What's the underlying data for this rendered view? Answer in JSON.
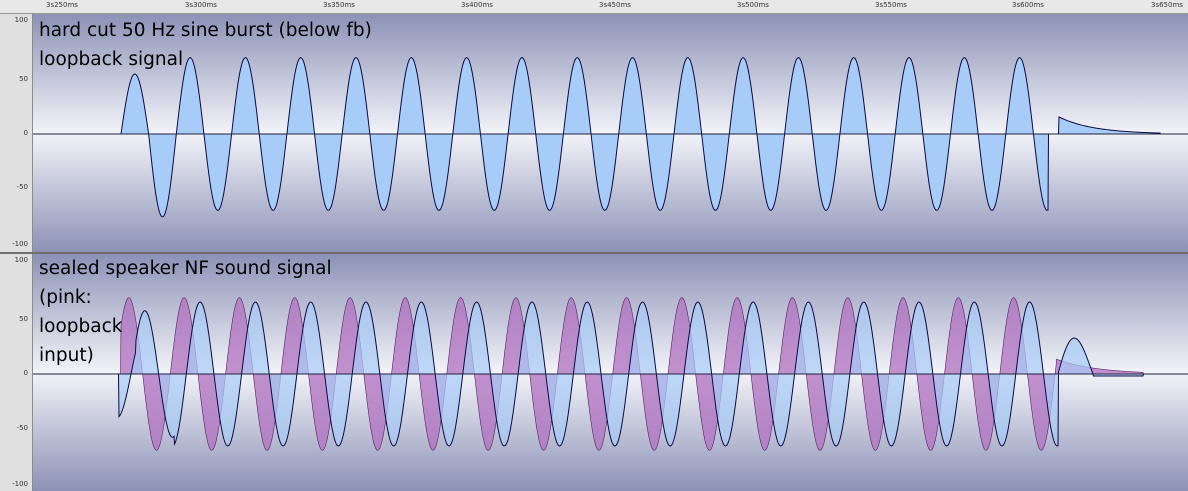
{
  "ruler": {
    "labels": [
      "3s250ms",
      "3s300ms",
      "3s350ms",
      "3s400ms",
      "3s450ms",
      "3s500ms",
      "3s550ms",
      "3s600ms",
      "3s650ms"
    ]
  },
  "track1": {
    "label": "hard cut 50 Hz sine burst (below fb)\nloopback signal",
    "scale": [
      "100",
      "50",
      "0",
      "-50",
      "-100"
    ],
    "fill_color": "#a8ccf8",
    "stroke_color": "#0a0a40"
  },
  "track2": {
    "label": "sealed speaker NF sound signal\n(pink:\nloopback\ninput)",
    "scale": [
      "100",
      "50",
      "0",
      "-50",
      "-100"
    ],
    "fill_color": "#a8ccf8",
    "overlay_color": "#b070c0",
    "stroke_color": "#0a0a40"
  },
  "colors": {
    "track_bg_light": "#f2f3f8",
    "track_bg_dark": "#8c92b6",
    "zero_line": "#202040"
  }
}
